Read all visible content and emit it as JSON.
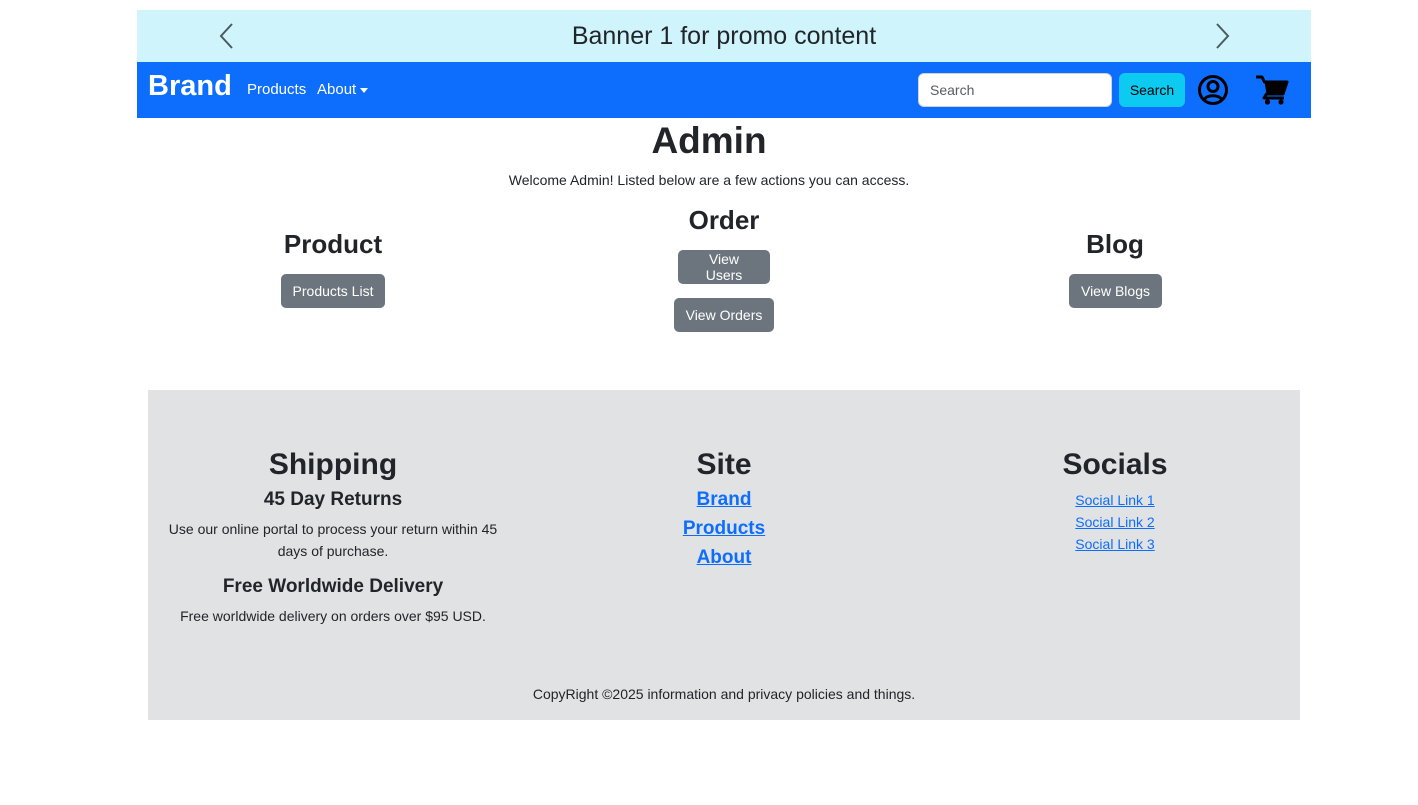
{
  "banner": {
    "text": "Banner 1 for promo content",
    "bg_color": "#cff4fc",
    "prev_icon": "chevron-left",
    "next_icon": "chevron-right"
  },
  "navbar": {
    "bg_color": "#0d6efd",
    "brand": "Brand",
    "links": [
      "Products",
      "About"
    ],
    "search_placeholder": "Search",
    "search_button": "Search",
    "icons": [
      "user-circle-icon",
      "shopping-cart-icon"
    ]
  },
  "main": {
    "title": "Admin",
    "welcome": "Welcome Admin! Listed below are a few actions you can access.",
    "sections": [
      {
        "heading": "Product",
        "buttons": [
          "Products List"
        ]
      },
      {
        "heading": "Order",
        "buttons": [
          "View Users",
          "View Orders"
        ]
      },
      {
        "heading": "Blog",
        "buttons": [
          "View Blogs"
        ]
      }
    ],
    "button_color": "#6c757d"
  },
  "footer": {
    "bg_color": "#e1e2e4",
    "shipping": {
      "heading": "Shipping",
      "returns_title": "45 Day Returns",
      "returns_text": "Use our online portal to process your return within 45 days of purchase.",
      "delivery_title": "Free Worldwide Delivery",
      "delivery_text": "Free worldwide delivery on orders over $95 USD."
    },
    "site": {
      "heading": "Site",
      "links": [
        "Brand",
        "Products",
        "About"
      ]
    },
    "socials": {
      "heading": "Socials",
      "links": [
        "Social Link 1",
        "Social Link 2",
        "Social Link 3"
      ]
    },
    "copyright": "CopyRight ©2025 information and privacy policies and things."
  }
}
